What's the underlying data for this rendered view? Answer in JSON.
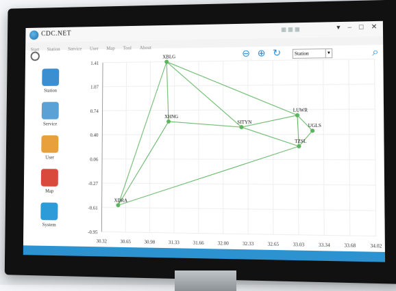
{
  "app": {
    "title": "CDC.NET"
  },
  "menu": [
    "Start",
    "Station",
    "Service",
    "User",
    "Map",
    "Tool",
    "About"
  ],
  "toolbar": {
    "station_select": "Station"
  },
  "sidebar": {
    "items": [
      {
        "label": "Station",
        "icon": "antenna-icon",
        "color": "#3b8fd1"
      },
      {
        "label": "Service",
        "icon": "satellite-icon",
        "color": "#5aa2d6"
      },
      {
        "label": "User",
        "icon": "users-icon",
        "color": "#e7a03b"
      },
      {
        "label": "Map",
        "icon": "map-pin-icon",
        "color": "#d94a3c"
      },
      {
        "label": "System",
        "icon": "cube-icon",
        "color": "#2e9bd9"
      }
    ]
  },
  "chart_data": {
    "type": "scatter",
    "y_ticks": [
      "1.41",
      "1.07",
      "0.74",
      "0.40",
      "0.06",
      "-0.27",
      "-0.61",
      "-0.95"
    ],
    "x_ticks": [
      "30.32",
      "30.65",
      "30.98",
      "31.33",
      "31.66",
      "32.00",
      "32.33",
      "32.65",
      "33.03",
      "33.34",
      "33.68",
      "34.02"
    ],
    "ylim": [
      -0.95,
      1.41
    ],
    "xlim": [
      30.32,
      34.02
    ],
    "line_color": "#5db35f",
    "nodes": [
      {
        "name": "XBLG",
        "x": 31.22,
        "y": 1.41
      },
      {
        "name": "XHNG",
        "x": 31.25,
        "y": 0.58
      },
      {
        "name": "SITYN",
        "x": 32.25,
        "y": 0.5
      },
      {
        "name": "LUWR",
        "x": 33.0,
        "y": 0.66
      },
      {
        "name": "UGLS",
        "x": 33.2,
        "y": 0.45
      },
      {
        "name": "TZSL",
        "x": 33.02,
        "y": 0.24
      },
      {
        "name": "XDRA",
        "x": 30.55,
        "y": -0.58
      }
    ],
    "edges": [
      [
        "XBLG",
        "XHNG"
      ],
      [
        "XBLG",
        "SITYN"
      ],
      [
        "XBLG",
        "LUWR"
      ],
      [
        "XBLG",
        "XDRA"
      ],
      [
        "XHNG",
        "SITYN"
      ],
      [
        "XHNG",
        "XDRA"
      ],
      [
        "SITYN",
        "LUWR"
      ],
      [
        "SITYN",
        "TZSL"
      ],
      [
        "LUWR",
        "UGLS"
      ],
      [
        "LUWR",
        "TZSL"
      ],
      [
        "UGLS",
        "TZSL"
      ],
      [
        "XDRA",
        "TZSL"
      ]
    ]
  }
}
